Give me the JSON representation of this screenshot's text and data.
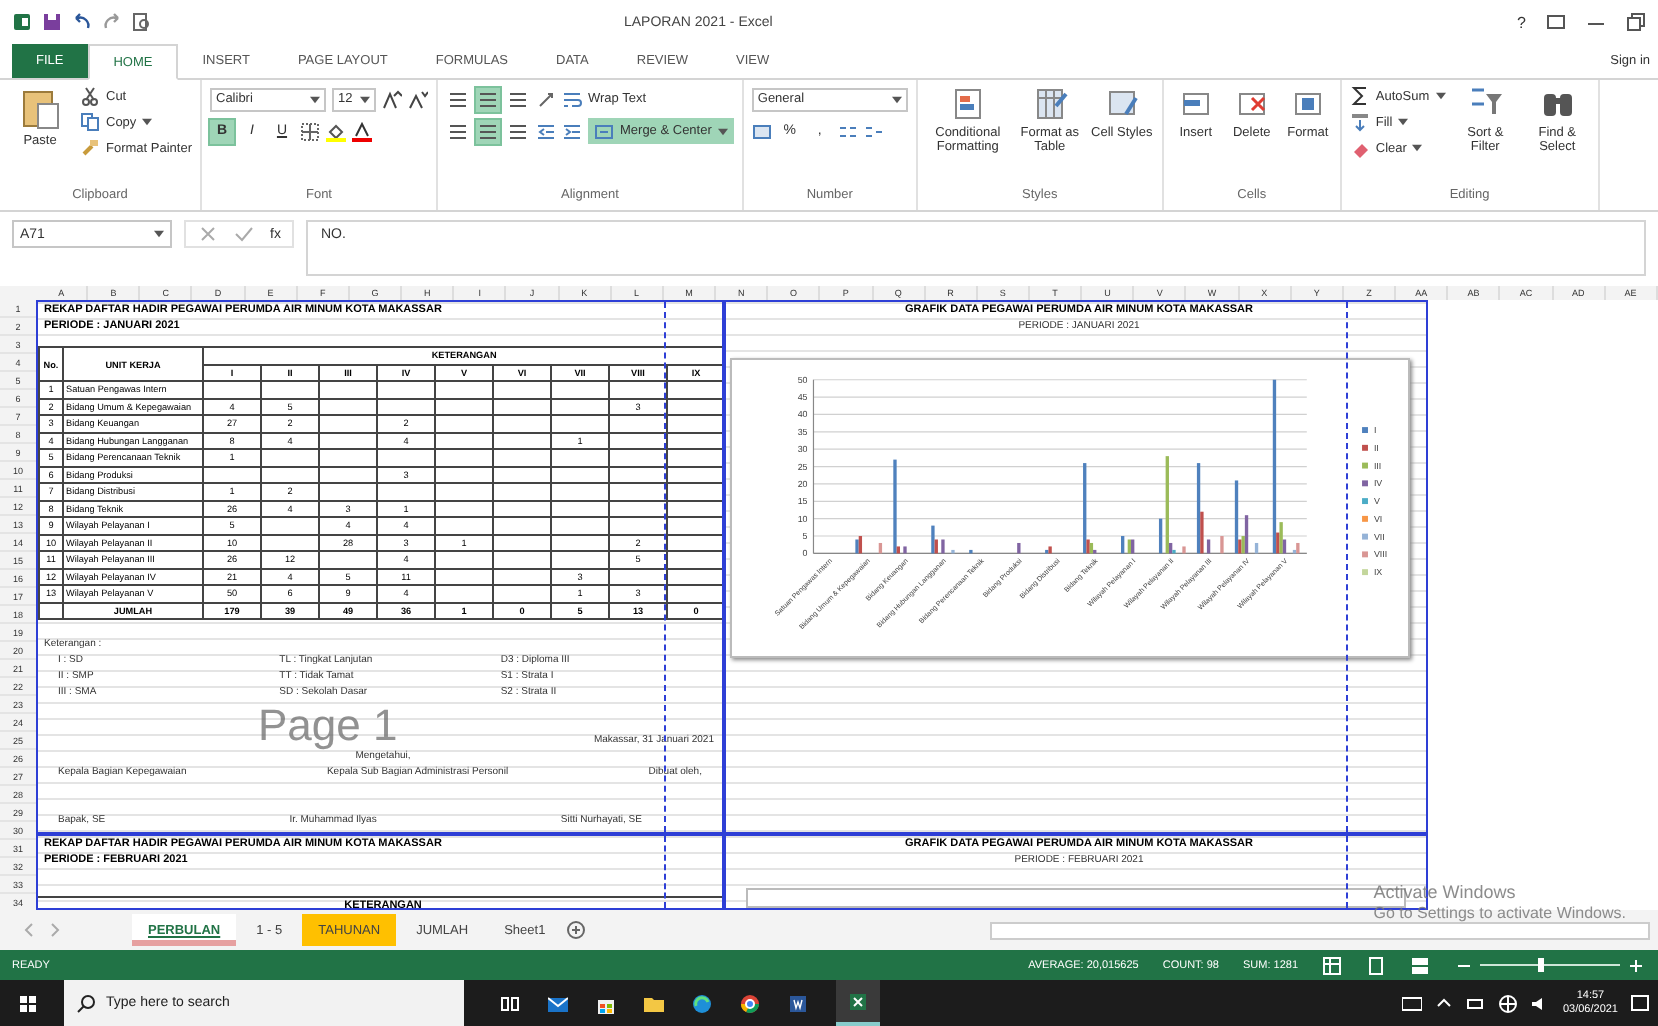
{
  "title_bar": {
    "title": "LAPORAN 2021 - Excel",
    "help": "?"
  },
  "ribbon_tabs": [
    {
      "label": "FILE",
      "kind": "file",
      "selected": false
    },
    {
      "label": "HOME",
      "kind": "tab",
      "selected": true
    },
    {
      "label": "INSERT",
      "kind": "tab",
      "selected": false
    },
    {
      "label": "PAGE LAYOUT",
      "kind": "tab",
      "selected": false
    },
    {
      "label": "FORMULAS",
      "kind": "tab",
      "selected": false
    },
    {
      "label": "DATA",
      "kind": "tab",
      "selected": false
    },
    {
      "label": "REVIEW",
      "kind": "tab",
      "selected": false
    },
    {
      "label": "VIEW",
      "kind": "tab",
      "selected": false
    }
  ],
  "sign_in": "Sign in",
  "ribbon": {
    "clipboard": {
      "label": "Clipboard",
      "paste": "Paste",
      "cut": "Cut",
      "copy": "Copy",
      "format_painter": "Format Painter"
    },
    "font": {
      "label": "Font",
      "font_name": "Calibri",
      "font_size": "12",
      "styles": [
        {
          "text": "B",
          "on": true
        },
        {
          "text": "I",
          "on": false
        },
        {
          "text": "U",
          "on": false
        }
      ]
    },
    "alignment": {
      "label": "Alignment",
      "vertical_align": [
        {
          "selected": false
        },
        {
          "selected": true
        },
        {
          "selected": false
        }
      ],
      "horizontal_align": [
        {
          "selected": false
        },
        {
          "selected": true
        },
        {
          "selected": false
        }
      ],
      "wrap_text": "Wrap Text",
      "merge_center": {
        "label": "Merge & Center",
        "on": true
      }
    },
    "number": {
      "label": "Number",
      "format": "General",
      "percent": "%",
      "comma": ","
    },
    "styles": {
      "label": "Styles",
      "buttons": [
        "Conditional Formatting",
        "Format as Table",
        "Cell Styles"
      ]
    },
    "cells": {
      "label": "Cells",
      "buttons": [
        "Insert",
        "Delete",
        "Format"
      ]
    },
    "editing": {
      "label": "Editing",
      "autosum": "AutoSum",
      "fill": "Fill",
      "clear": "Clear",
      "sort": "Sort & Filter",
      "find": "Find & Select"
    }
  },
  "formula_bar": {
    "name_box": "A71",
    "fx": "fx",
    "content": "NO."
  },
  "sheet": {
    "columns": [
      "A",
      "B",
      "C",
      "D",
      "E",
      "F",
      "G",
      "H",
      "I",
      "J",
      "K",
      "L",
      "M",
      "N",
      "O",
      "P",
      "Q",
      "R",
      "S",
      "T",
      "U",
      "V",
      "W",
      "X",
      "Y",
      "Z",
      "AA",
      "AB",
      "AC",
      "AD",
      "AE"
    ],
    "rows": [
      "1",
      "2",
      "3",
      "4",
      "5",
      "6",
      "7",
      "8",
      "9",
      "10",
      "11",
      "12",
      "13",
      "14",
      "15",
      "16",
      "17",
      "18",
      "19",
      "20",
      "21",
      "22",
      "23",
      "24",
      "25",
      "26",
      "27",
      "28",
      "29",
      "30",
      "31",
      "32",
      "33",
      "34"
    ],
    "page_label": "Page 1",
    "report": {
      "title": "REKAP DAFTAR HADIR PEGAWAI PERUMDA AIR MINUM KOTA MAKASSAR",
      "period": "PERIODE : JANUARI 2021",
      "no_header": "No.",
      "unit_header": "UNIT KERJA",
      "group_header": "KETERANGAN",
      "levels": [
        "I",
        "II",
        "III",
        "IV",
        "V",
        "VI",
        "VII",
        "VIII",
        "IX"
      ],
      "rows": [
        {
          "no": "1",
          "unit": "Satuan Pengawas Intern",
          "values": {}
        },
        {
          "no": "2",
          "unit": "Bidang Umum & Kepegawaian",
          "values": {
            "c1": "4",
            "c2": "5",
            "c8": "3"
          }
        },
        {
          "no": "3",
          "unit": "Bidang Keuangan",
          "values": {
            "c1": "27",
            "c2": "2",
            "c4": "2"
          }
        },
        {
          "no": "4",
          "unit": "Bidang Hubungan Langganan",
          "values": {
            "c1": "8",
            "c2": "4",
            "c4": "4",
            "c7": "1"
          }
        },
        {
          "no": "5",
          "unit": "Bidang Perencanaan Teknik",
          "values": {
            "c1": "1"
          }
        },
        {
          "no": "6",
          "unit": "Bidang Produksi",
          "values": {
            "c4": "3"
          }
        },
        {
          "no": "7",
          "unit": "Bidang Distribusi",
          "values": {
            "c1": "1",
            "c2": "2"
          }
        },
        {
          "no": "8",
          "unit": "Bidang Teknik",
          "values": {
            "c1": "26",
            "c2": "4",
            "c3": "3",
            "c4": "1"
          }
        },
        {
          "no": "9",
          "unit": "Wilayah Pelayanan I",
          "values": {
            "c1": "5",
            "c3": "4",
            "c4": "4"
          }
        },
        {
          "no": "10",
          "unit": "Wilayah Pelayanan II",
          "values": {
            "c1": "10",
            "c3": "28",
            "c4": "3",
            "c5": "1",
            "c8": "2"
          }
        },
        {
          "no": "11",
          "unit": "Wilayah Pelayanan III",
          "values": {
            "c1": "26",
            "c2": "12",
            "c4": "4",
            "c8": "5"
          }
        },
        {
          "no": "12",
          "unit": "Wilayah Pelayanan IV",
          "values": {
            "c1": "21",
            "c2": "4",
            "c3": "5",
            "c4": "11",
            "c7": "3"
          }
        },
        {
          "no": "13",
          "unit": "Wilayah Pelayanan V",
          "values": {
            "c1": "50",
            "c2": "6",
            "c3": "9",
            "c4": "4",
            "c7": "1",
            "c8": "3"
          }
        }
      ],
      "total_label": "JUMLAH",
      "totals": [
        "179",
        "39",
        "49",
        "36",
        "1",
        "0",
        "5",
        "13",
        "0"
      ],
      "notes_label": "Keterangan :",
      "notes": [
        "I : SD",
        "TL : Tingkat Lanjutan",
        "D3 : Diploma III",
        "II : SMP",
        "TT : Tidak Tamat",
        "S1 : Strata I",
        "III : SMA",
        "SD : Sekolah Dasar",
        "S2 : Strata II"
      ],
      "place_date": "Makassar, 31 Januari 2021",
      "acknowledged": "Mengetahui,",
      "positions": [
        "Kepala Bagian Kepegawaian",
        "Kepala Sub Bagian Administrasi Personil",
        "Dibuat oleh,"
      ],
      "names": [
        "Bapak, SE",
        "Ir. Muhammad Ilyas",
        "Sitti Nurhayati, SE"
      ]
    },
    "page2": {
      "title": "REKAP DAFTAR HADIR PEGAWAI PERUMDA AIR MINUM KOTA MAKASSAR",
      "period": "PERIODE : FEBRUARI 2021",
      "group_header": "KETERANGAN",
      "chart_title": "GRAFIK DATA PEGAWAI PERUMDA AIR MINUM KOTA MAKASSAR",
      "chart_period": "PERIODE : FEBRUARI 2021"
    },
    "chart_panel": {
      "title": "GRAFIK DATA PEGAWAI PERUMDA AIR MINUM KOTA MAKASSAR",
      "period": "PERIODE : JANUARI 2021",
      "chart_data": {
        "type": "bar",
        "categories": [
          "Satuan Pengawas Intern",
          "Bidang Umum & Kepegawaian",
          "Bidang Keuangan",
          "Bidang Hubungan Langganan",
          "Bidang Perencanaan Teknik",
          "Bidang Produksi",
          "Bidang Distribusi",
          "Bidang Teknik",
          "Wilayah Pelayanan I",
          "Wilayah Pelayanan II",
          "Wilayah Pelayanan III",
          "Wilayah Pelayanan IV",
          "Wilayah Pelayanan V"
        ],
        "ylim": [
          0,
          50
        ],
        "grid": true,
        "legend": "right",
        "yticks": [
          0,
          5,
          10,
          15,
          20,
          25,
          30,
          35,
          40,
          45,
          50
        ],
        "series": [
          {
            "name": "I",
            "color": "#4f81bd",
            "values": [
              null,
              4,
              27,
              8,
              1,
              null,
              1,
              26,
              5,
              10,
              26,
              21,
              50
            ]
          },
          {
            "name": "II",
            "color": "#c0504d",
            "values": [
              null,
              5,
              2,
              4,
              null,
              null,
              2,
              4,
              null,
              null,
              12,
              4,
              6
            ]
          },
          {
            "name": "III",
            "color": "#9bbb59",
            "values": [
              null,
              null,
              null,
              null,
              null,
              null,
              null,
              3,
              4,
              28,
              null,
              5,
              9
            ]
          },
          {
            "name": "IV",
            "color": "#8064a2",
            "values": [
              null,
              null,
              2,
              4,
              null,
              3,
              null,
              1,
              4,
              3,
              4,
              11,
              4
            ]
          },
          {
            "name": "V",
            "color": "#4bacc6",
            "values": [
              null,
              null,
              null,
              null,
              null,
              null,
              null,
              null,
              null,
              1,
              null,
              null,
              null
            ]
          },
          {
            "name": "VI",
            "color": "#f79646",
            "values": [
              null,
              null,
              null,
              null,
              null,
              null,
              null,
              null,
              null,
              null,
              null,
              null,
              null
            ]
          },
          {
            "name": "VII",
            "color": "#95b3d7",
            "values": [
              null,
              null,
              null,
              1,
              null,
              null,
              null,
              null,
              null,
              null,
              null,
              3,
              1
            ]
          },
          {
            "name": "VIII",
            "color": "#d99694",
            "values": [
              null,
              3,
              null,
              null,
              null,
              null,
              null,
              null,
              null,
              2,
              5,
              null,
              3
            ]
          },
          {
            "name": "IX",
            "color": "#c3d69b",
            "values": [
              null,
              null,
              null,
              null,
              null,
              null,
              null,
              null,
              null,
              null,
              null,
              null,
              null
            ]
          }
        ]
      }
    }
  },
  "sheet_tabs": [
    {
      "label": "PERBULAN",
      "selected": true,
      "color": "#e6a0a0"
    },
    {
      "label": "1 - 5",
      "selected": false
    },
    {
      "label": "TAHUNAN",
      "selected": false,
      "color": "#ffc000"
    },
    {
      "label": "JUMLAH",
      "selected": false
    },
    {
      "label": "Sheet1",
      "selected": false
    }
  ],
  "activation": {
    "title": "Activate Windows",
    "hint": "Go to Settings to activate Windows."
  },
  "status_bar": {
    "mode": "READY",
    "average": "AVERAGE: 20,015625",
    "count": "COUNT: 98",
    "sum": "SUM: 1281",
    "zoom": {
      "level": 0.42
    }
  },
  "taskbar": {
    "search_placeholder": "Type here to search",
    "time": "14:57",
    "date": "03/06/2021"
  }
}
